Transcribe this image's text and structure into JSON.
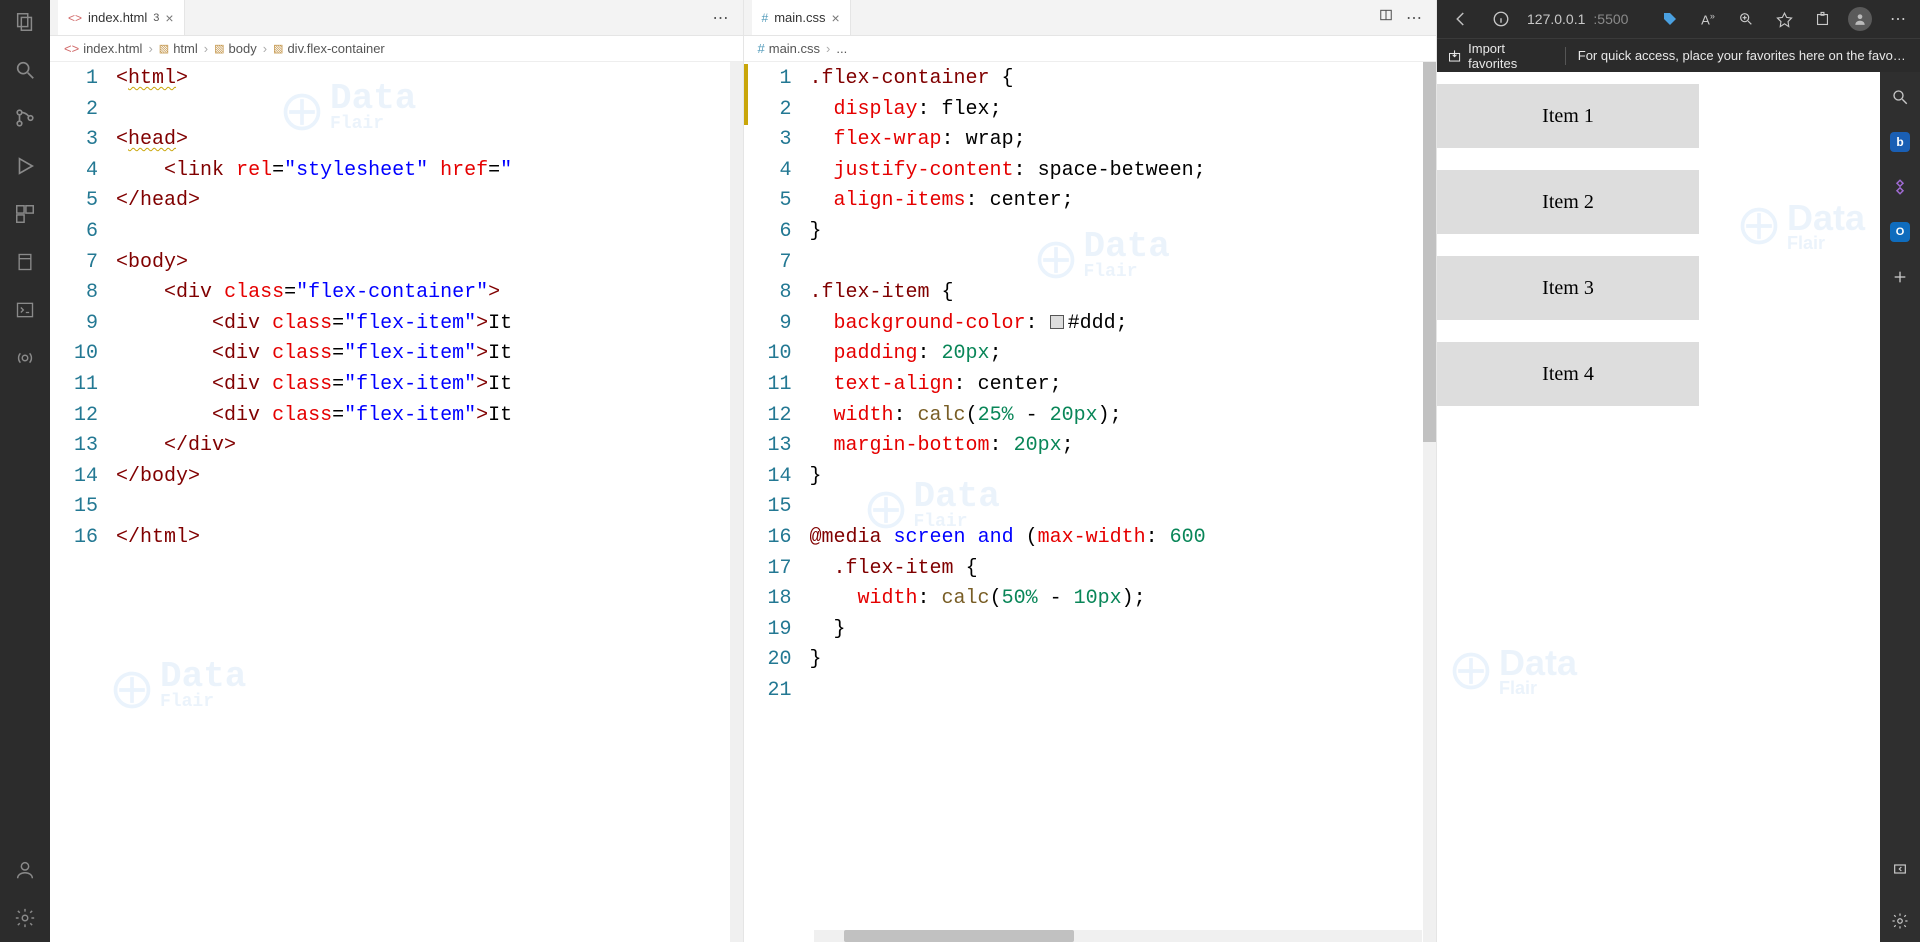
{
  "tabs": {
    "left": {
      "name": "index.html",
      "dirty": "3"
    },
    "right": {
      "name": "main.css"
    }
  },
  "breadcrumbs": {
    "left": [
      "index.html",
      "html",
      "body",
      "div.flex-container"
    ],
    "right": [
      "main.css",
      "..."
    ]
  },
  "html_lines": 16,
  "css_lines": 21,
  "html_code": {
    "l1": "<html>",
    "l3": "<head>",
    "l4_attr1": "rel",
    "l4_val1": "\"stylesheet\"",
    "l4_attr2": "href",
    "l4_val2": "\"",
    "l5": "</head>",
    "l7": "<body>",
    "l8_cls": "\"flex-container\"",
    "item_cls": "\"flex-item\"",
    "item_txt": "It",
    "l13": "</div>",
    "l14": "</body>",
    "l16": "</html>"
  },
  "css_code": {
    "sel1": ".flex-container",
    "p_display": "display",
    "v_display": "flex",
    "p_flexwrap": "flex-wrap",
    "v_flexwrap": "wrap",
    "p_justify": "justify-content",
    "v_justify": "space-between",
    "p_align": "align-items",
    "v_align": "center",
    "sel2": ".flex-item",
    "p_bg": "background-color",
    "v_bg": "#ddd",
    "p_pad": "padding",
    "v_pad": "20px",
    "p_ta": "text-align",
    "v_ta": "center",
    "p_w": "width",
    "v_w_calc": "calc",
    "v_w_inner_a": "25%",
    "v_w_inner_b": "20px",
    "p_mb": "margin-bottom",
    "v_mb": "20px",
    "media_at": "@media",
    "media_screen": "screen",
    "media_and": "and",
    "media_prop": "max-width",
    "media_val": "600",
    "p_w2_inner_a": "50%",
    "p_w2_inner_b": "10px"
  },
  "browser": {
    "host": "127.0.0.1",
    "port": ":5500",
    "import_fav": "Import favorites",
    "fav_msg": "For quick access, place your favorites here on the favorites...",
    "items": [
      "Item 1",
      "Item 2",
      "Item 3",
      "Item 4"
    ]
  },
  "watermark": {
    "line1": "Data",
    "line2": "Flair"
  }
}
